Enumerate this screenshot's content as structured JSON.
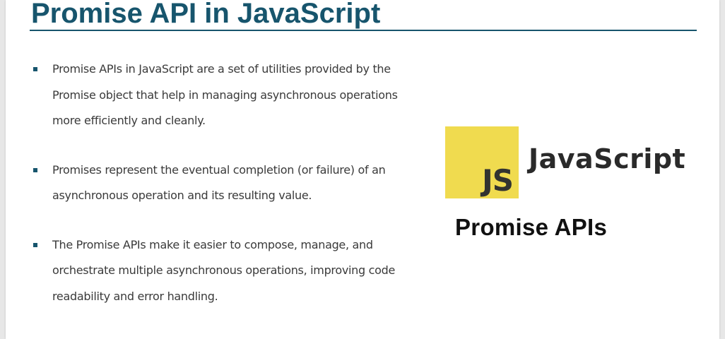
{
  "title": "Promise API in JavaScript",
  "bullets": [
    {
      "lines": [
        "Promise APIs in JavaScript are a set of utilities provided by the",
        "Promise object that help in managing asynchronous operations",
        "more efficiently and cleanly."
      ]
    },
    {
      "lines": [
        "Promises represent the eventual completion (or failure) of an",
        "asynchronous operation and its resulting value."
      ]
    },
    {
      "lines": [
        "The Promise APIs make it easier to compose, manage, and",
        "orchestrate multiple asynchronous operations, improving code",
        "readability and error handling."
      ]
    }
  ],
  "logo": {
    "badge_text": "JS",
    "wordmark": "JavaScript",
    "badge_color": "#f0db4f"
  },
  "caption": "Promise APIs",
  "colors": {
    "title": "#17556d",
    "bullet_marker": "#17556d",
    "body_text": "#3a3a3a"
  }
}
